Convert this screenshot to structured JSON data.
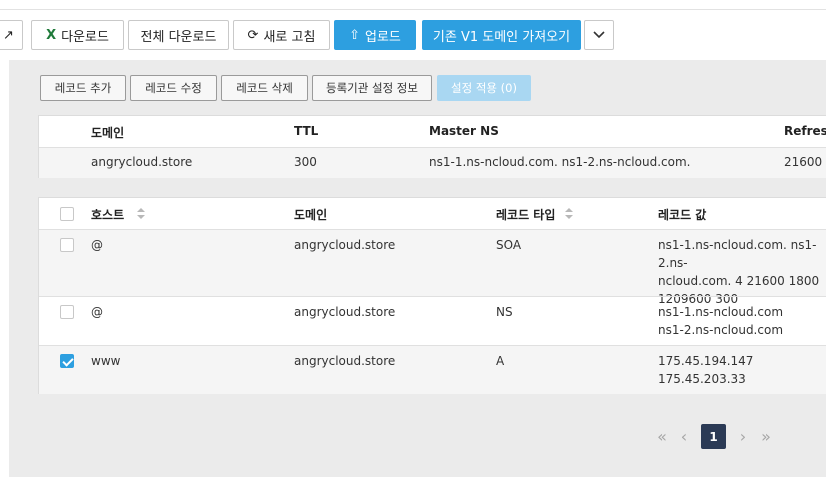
{
  "toolbar": {
    "download_label": "다운로드",
    "download_all_label": "전체 다운로드",
    "refresh_label": "새로 고침",
    "upload_label": "업로드",
    "import_v1_label": "기존 V1 도메인 가져오기"
  },
  "actions": {
    "add_record": "레코드 추가",
    "edit_record": "레코드 수정",
    "delete_record": "레코드 삭제",
    "registrar_settings": "등록기관 설정 정보",
    "apply_settings": "설정 적용 (0)"
  },
  "domain_table": {
    "headers": {
      "domain": "도메인",
      "ttl": "TTL",
      "master_ns": "Master NS",
      "refresh": "Refresh"
    },
    "row": {
      "domain": "angrycloud.store",
      "ttl": "300",
      "master_ns": "ns1-1.ns-ncloud.com. ns1-2.ns-ncloud.com.",
      "refresh": "21600"
    }
  },
  "record_table": {
    "headers": {
      "host": "호스트",
      "domain": "도메인",
      "type": "레코드 타입",
      "value": "레코드 값"
    },
    "rows": [
      {
        "host": "@",
        "domain": "angrycloud.store",
        "type": "SOA",
        "value_lines": [
          "ns1-1.ns-ncloud.com. ns1-2.ns-",
          "ncloud.com. 4 21600 1800",
          "1209600 300"
        ],
        "checked": false
      },
      {
        "host": "@",
        "domain": "angrycloud.store",
        "type": "NS",
        "value_lines": [
          "ns1-1.ns-ncloud.com",
          "ns1-2.ns-ncloud.com"
        ],
        "checked": false
      },
      {
        "host": "www",
        "domain": "angrycloud.store",
        "type": "A",
        "value_lines": [
          "175.45.194.147",
          "175.45.203.33"
        ],
        "checked": true
      }
    ]
  },
  "pagination": {
    "current_page": "1"
  },
  "colors": {
    "primary": "#2d9fe0",
    "disabled_button": "#a9d7f2",
    "pager_active": "#2b3a55"
  }
}
